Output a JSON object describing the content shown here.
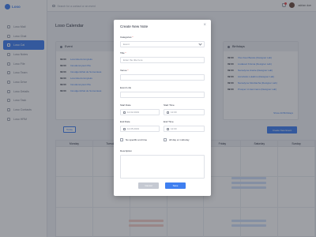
{
  "app": {
    "logo_text": "Loso"
  },
  "sidebar": {
    "items": [
      {
        "label": "Loso Mail"
      },
      {
        "label": "Loso Chat"
      },
      {
        "label": "Loso Cal"
      },
      {
        "label": "Loso Notes"
      },
      {
        "label": "Loso File"
      },
      {
        "label": "Loso Team"
      },
      {
        "label": "Loso Drive"
      },
      {
        "label": "Loso Details"
      },
      {
        "label": "Loso Task"
      },
      {
        "label": "Loso Contacts"
      },
      {
        "label": "Loso HRM"
      }
    ]
  },
  "topbar": {
    "search_placeholder": "Search for a contact or an event",
    "user_name": "adrian doe"
  },
  "page": {
    "title": "Loso Calendar"
  },
  "event_panel": {
    "title": "Event",
    "rows": [
      {
        "time": "09:00",
        "name": "Loremita dummyteks"
      },
      {
        "time": "09:00",
        "name": "Innodummytext Pla"
      },
      {
        "time": "09:00",
        "name": "Innodgembhat de Sumenteas"
      },
      {
        "time": "09:00",
        "name": "Loremita dummyteks"
      },
      {
        "time": "09:00",
        "name": "Innodummytext Pla"
      },
      {
        "time": "09:00",
        "name": "Innodgembhat de Sumenteas"
      }
    ]
  },
  "birthday_panel": {
    "title": "Birthdays",
    "rows": [
      {
        "time": "09:00",
        "name": "Vivo Feet Bessie (Designer Lab)"
      },
      {
        "time": "09:00",
        "name": "Lisdaved Krisma (Designer Lab)"
      },
      {
        "time": "09:00",
        "name": "Namelyme Anetie (Designer Lab)"
      },
      {
        "time": "09:00",
        "name": "Accurlebo Lutalimo (Designer Lab)"
      },
      {
        "time": "09:00",
        "name": "Namelyme Mordiacha (Designer Lab)"
      },
      {
        "time": "09:00",
        "name": "Prosper nt Hemmano (Designer Lab)"
      }
    ],
    "link": "Show All Birthdays"
  },
  "calendar": {
    "today_button": "Today",
    "create_button": "Create New Event",
    "weekdays": [
      "Monday",
      "Tuesday",
      "Wednesday",
      "Thursday",
      "Friday",
      "Saturday",
      "Sunday"
    ]
  },
  "modal": {
    "title": "Create New Note",
    "close_glyph": "×",
    "categories_label": "Categories",
    "categories_value": "Event",
    "title_label": "Title",
    "title_placeholder": "Enter the title here",
    "venue_label": "Venue",
    "event_link_label": "Event Link",
    "start_date_label": "Start Date",
    "start_date_placeholder": "12.02.2019",
    "start_time_label": "Start Time",
    "start_time_placeholder": "12:00",
    "end_date_label": "End Date",
    "end_date_placeholder": "12.05.2019",
    "end_time_label": "End Time",
    "end_time_placeholder": "12:00",
    "no_specific_label": "No specific end time",
    "all_day_label": "All day or multi-day",
    "description_label": "Description",
    "cancel_button": "Cancel",
    "save_button": "Save"
  },
  "colors": {
    "accent": "#3f7ff0",
    "danger": "#e54a4a",
    "muted": "#c5c9d2"
  }
}
